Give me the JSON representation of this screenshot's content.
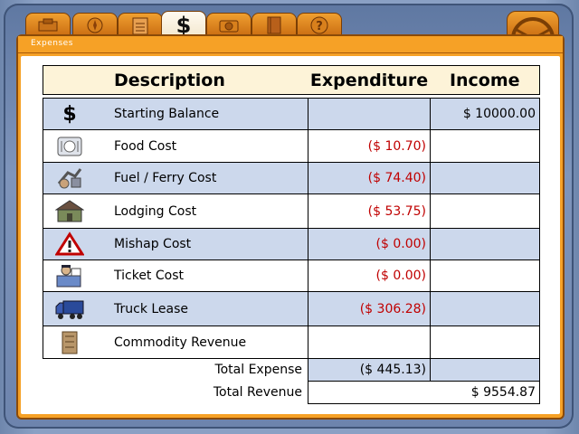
{
  "tabs": [
    {
      "icon": "truck-tab-icon"
    },
    {
      "icon": "compass-tab-icon"
    },
    {
      "icon": "clipboard-tab-icon"
    },
    {
      "icon": "dollar-tab-icon",
      "label": "$",
      "active": true
    },
    {
      "icon": "camera-tab-icon"
    },
    {
      "icon": "notebook-tab-icon"
    },
    {
      "icon": "help-tab-icon"
    }
  ],
  "panel": {
    "title": "Expenses"
  },
  "table": {
    "headers": {
      "description": "Description",
      "expenditure": "Expenditure",
      "income": "Income"
    },
    "rows": [
      {
        "icon": "dollar-icon",
        "icon_text": "$",
        "description": "Starting Balance",
        "expenditure": "",
        "income": "$ 10000.00"
      },
      {
        "icon": "food-plate-icon",
        "description": "Food Cost",
        "expenditure": "($ 10.70)",
        "income": ""
      },
      {
        "icon": "fuel-pump-icon",
        "description": "Fuel / Ferry Cost",
        "expenditure": "($ 74.40)",
        "income": ""
      },
      {
        "icon": "lodging-icon",
        "description": "Lodging Cost",
        "expenditure": "($ 53.75)",
        "income": ""
      },
      {
        "icon": "warning-triangle-icon",
        "description": "Mishap Cost",
        "expenditure": "($ 0.00)",
        "income": ""
      },
      {
        "icon": "police-ticket-icon",
        "description": "Ticket Cost",
        "expenditure": "($ 0.00)",
        "income": ""
      },
      {
        "icon": "truck-icon",
        "description": "Truck Lease",
        "expenditure": "($ 306.28)",
        "income": ""
      },
      {
        "icon": "cargo-crate-icon",
        "description": "Commodity Revenue",
        "expenditure": "",
        "income": ""
      }
    ],
    "totals": {
      "expense_label": "Total Expense",
      "expense_value": "($ 445.13)",
      "revenue_label": "Total Revenue",
      "revenue_value": "$ 9554.87"
    }
  },
  "colors": {
    "accent": "#f6a126",
    "row_shade": "#ccd8ec",
    "negative": "#c00000",
    "header_bg": "#fdf3d8"
  }
}
